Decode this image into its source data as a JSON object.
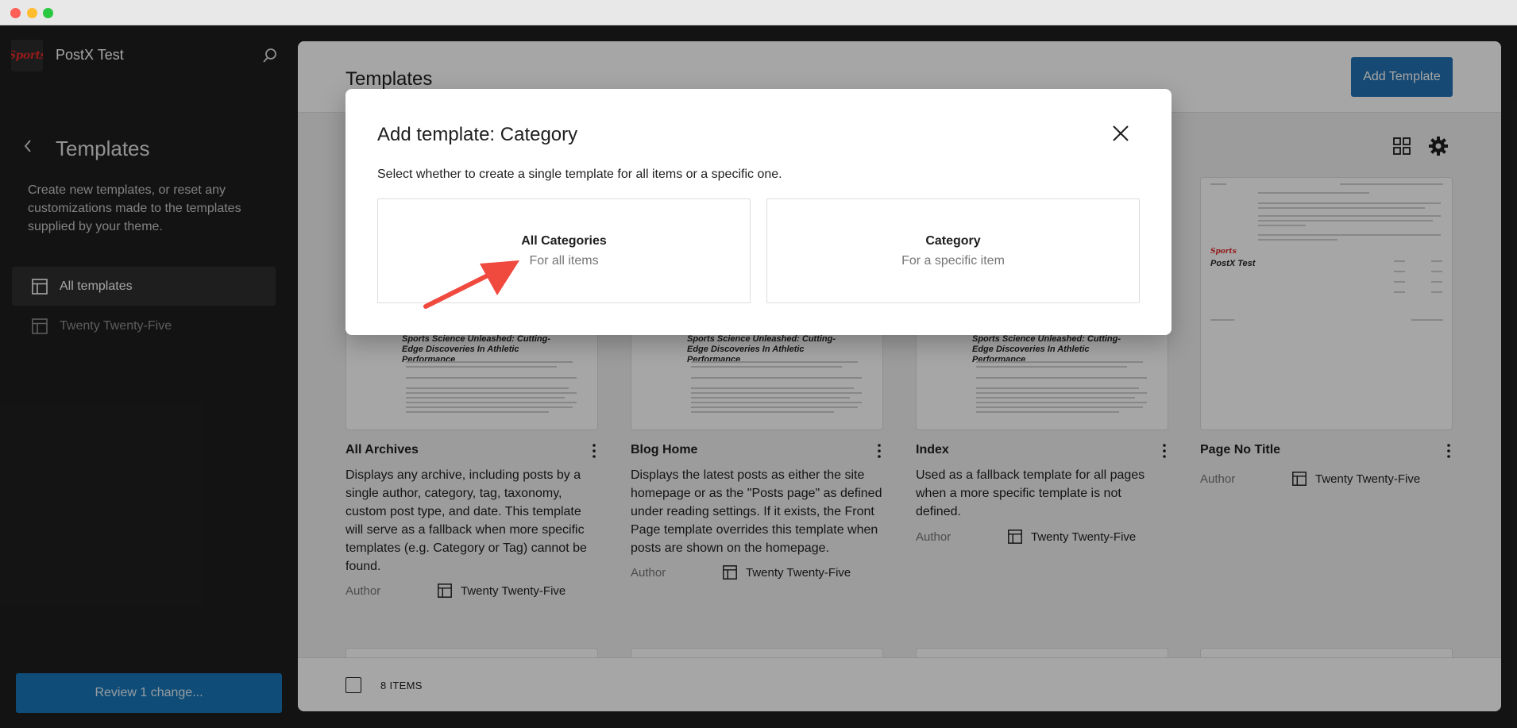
{
  "site": {
    "name": "PostX Test",
    "logo_text": "Sports"
  },
  "sidebar": {
    "title": "Templates",
    "description": "Create new templates, or reset any customizations made to the templates supplied by your theme.",
    "items": [
      {
        "label": "All templates"
      },
      {
        "label": "Twenty Twenty-Five"
      }
    ],
    "review_button": "Review 1 change..."
  },
  "main": {
    "title": "Templates",
    "add_button": "Add Template",
    "cards": [
      {
        "title": "All Archives",
        "thumb_heading": "Sports Science Unleashed: Cutting-Edge Discoveries In Athletic Performance",
        "description": "Displays any archive, including posts by a single author, category, tag, taxonomy, custom post type, and date. This template will serve as a fallback when more specific templates (e.g. Category or Tag) cannot be found.",
        "author_label": "Author",
        "theme": "Twenty Twenty-Five"
      },
      {
        "title": "Blog Home",
        "thumb_heading": "Sports Science Unleashed: Cutting-Edge Discoveries In Athletic Performance",
        "description": "Displays the latest posts as either the site homepage or as the \"Posts page\" as defined under reading settings. If it exists, the Front Page template overrides this template when posts are shown on the homepage.",
        "author_label": "Author",
        "theme": "Twenty Twenty-Five"
      },
      {
        "title": "Index",
        "thumb_heading": "Sports Science Unleashed: Cutting-Edge Discoveries In Athletic Performance",
        "description": "Used as a fallback template for all pages when a more specific template is not defined.",
        "author_label": "Author",
        "theme": "Twenty Twenty-Five"
      },
      {
        "title": "Page No Title",
        "thumb_heading": "PostX Test",
        "description": "",
        "author_label": "Author",
        "theme": "Twenty Twenty-Five"
      }
    ],
    "footer": {
      "count": "8 ITEMS"
    }
  },
  "modal": {
    "title": "Add template: Category",
    "description": "Select whether to create a single template for all items or a specific one.",
    "options": [
      {
        "title": "All Categories",
        "subtitle": "For all items"
      },
      {
        "title": "Category",
        "subtitle": "For a specific item"
      }
    ]
  },
  "colors": {
    "accent": "#2271b1",
    "review": "#1877b8",
    "arrow": "#f0493e"
  }
}
